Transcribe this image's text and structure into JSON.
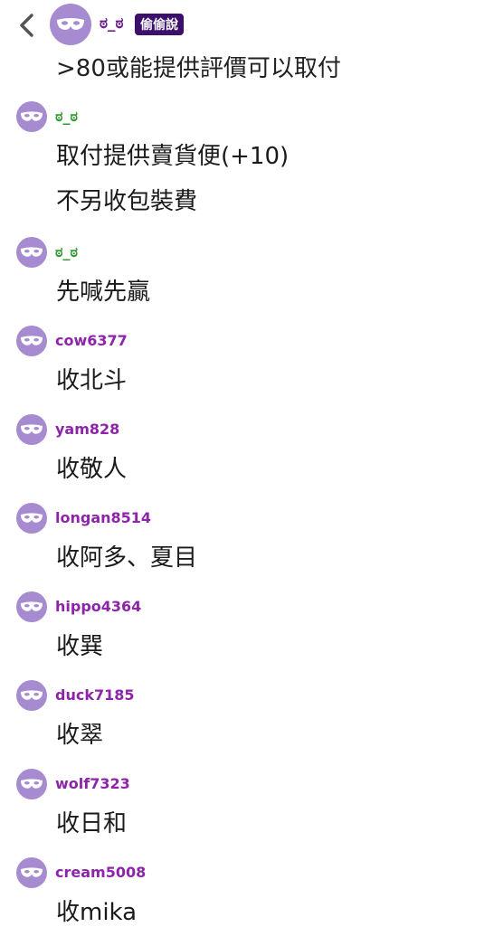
{
  "header": {
    "back_icon": "chevron-left-icon",
    "avatar_icon": "mask-icon",
    "name": "ಠ_ಠ",
    "badge": "偷偷說"
  },
  "partial_text": ">80或能提供評價可以取付",
  "messages": [
    {
      "user": "ಠ_ಠ",
      "lines": [
        "取付提供賣貨便(+10)",
        "不另收包裝費"
      ]
    },
    {
      "user": "ಠ_ಠ",
      "lines": [
        "先喊先贏"
      ]
    },
    {
      "user": "cow6377",
      "lines": [
        "收北斗"
      ]
    },
    {
      "user": "yam828",
      "lines": [
        "收敬人"
      ]
    },
    {
      "user": "longan8514",
      "lines": [
        "收阿多、夏目"
      ]
    },
    {
      "user": "hippo4364",
      "lines": [
        "收巽"
      ]
    },
    {
      "user": "duck7185",
      "lines": [
        "收翠"
      ]
    },
    {
      "user": "wolf7323",
      "lines": [
        "收日和"
      ]
    },
    {
      "user": "cream5008",
      "lines": [
        "收mika"
      ]
    }
  ],
  "colors": {
    "avatar": "#a78bd0",
    "username": "#8e24aa",
    "author_username": "#2e9a2e",
    "badge_bg": "#3b0f6b"
  }
}
